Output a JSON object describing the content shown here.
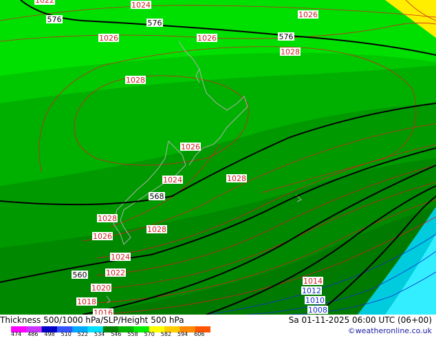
{
  "map": {
    "isobar_labels": [
      "1022",
      "1024",
      "1026",
      "1026",
      "1026",
      "1028",
      "1028",
      "1026",
      "1024",
      "1028",
      "1028",
      "1026",
      "1028",
      "1024",
      "1022",
      "1020",
      "1018",
      "1016",
      "1014",
      "1012",
      "1010",
      "1008"
    ],
    "thickness_labels": [
      "576",
      "576",
      "576",
      "568",
      "560"
    ]
  },
  "footer": {
    "title": "Thickness 500/1000 hPa/SLP/Height 500 hPa",
    "datetime": "Sa 01-11-2025 06:00 UTC (06+00)",
    "credit": "©weatheronline.co.uk",
    "scale_ticks": [
      "474",
      "486",
      "498",
      "510",
      "522",
      "534",
      "546",
      "558",
      "570",
      "582",
      "594",
      "606"
    ],
    "scale_colors": [
      "#ff00ff",
      "#cc33ff",
      "#0000c8",
      "#3355ff",
      "#00aaff",
      "#00e0ff",
      "#008000",
      "#00b400",
      "#00ee00",
      "#ffff00",
      "#ffcc00",
      "#ff8800",
      "#ff5500"
    ]
  },
  "colors": {
    "isobar_high": "#d02020",
    "isobar_low": "#1030d0",
    "thickness_line": "#000000"
  }
}
